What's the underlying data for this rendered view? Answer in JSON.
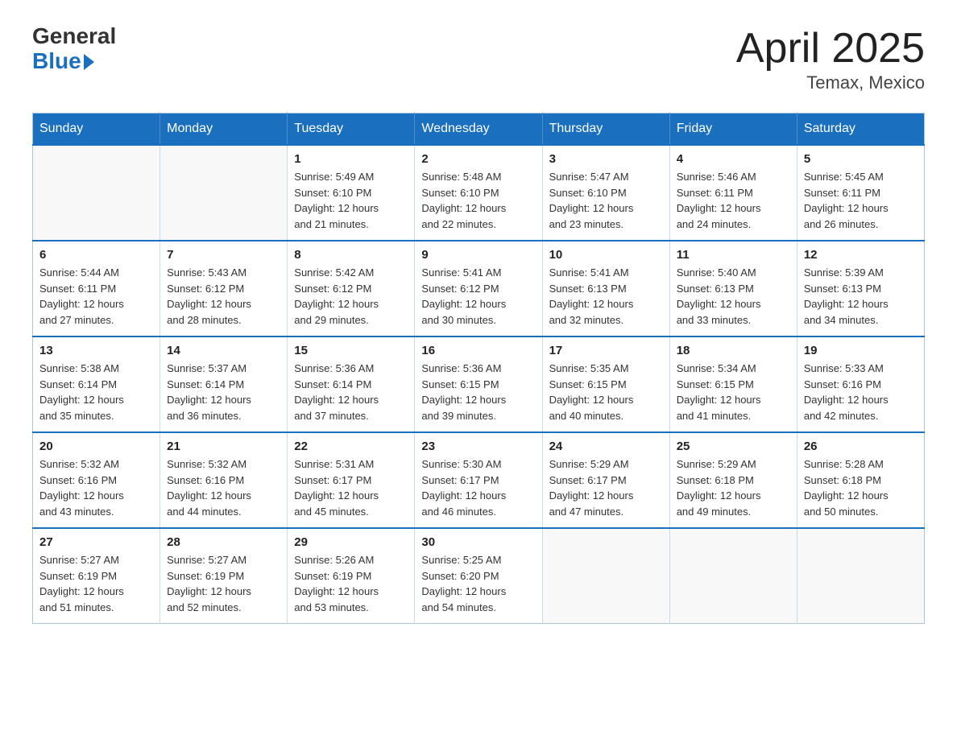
{
  "header": {
    "logo_general": "General",
    "logo_blue": "Blue",
    "title": "April 2025",
    "subtitle": "Temax, Mexico"
  },
  "calendar": {
    "days_of_week": [
      "Sunday",
      "Monday",
      "Tuesday",
      "Wednesday",
      "Thursday",
      "Friday",
      "Saturday"
    ],
    "weeks": [
      [
        {
          "day": "",
          "info": ""
        },
        {
          "day": "",
          "info": ""
        },
        {
          "day": "1",
          "info": "Sunrise: 5:49 AM\nSunset: 6:10 PM\nDaylight: 12 hours\nand 21 minutes."
        },
        {
          "day": "2",
          "info": "Sunrise: 5:48 AM\nSunset: 6:10 PM\nDaylight: 12 hours\nand 22 minutes."
        },
        {
          "day": "3",
          "info": "Sunrise: 5:47 AM\nSunset: 6:10 PM\nDaylight: 12 hours\nand 23 minutes."
        },
        {
          "day": "4",
          "info": "Sunrise: 5:46 AM\nSunset: 6:11 PM\nDaylight: 12 hours\nand 24 minutes."
        },
        {
          "day": "5",
          "info": "Sunrise: 5:45 AM\nSunset: 6:11 PM\nDaylight: 12 hours\nand 26 minutes."
        }
      ],
      [
        {
          "day": "6",
          "info": "Sunrise: 5:44 AM\nSunset: 6:11 PM\nDaylight: 12 hours\nand 27 minutes."
        },
        {
          "day": "7",
          "info": "Sunrise: 5:43 AM\nSunset: 6:12 PM\nDaylight: 12 hours\nand 28 minutes."
        },
        {
          "day": "8",
          "info": "Sunrise: 5:42 AM\nSunset: 6:12 PM\nDaylight: 12 hours\nand 29 minutes."
        },
        {
          "day": "9",
          "info": "Sunrise: 5:41 AM\nSunset: 6:12 PM\nDaylight: 12 hours\nand 30 minutes."
        },
        {
          "day": "10",
          "info": "Sunrise: 5:41 AM\nSunset: 6:13 PM\nDaylight: 12 hours\nand 32 minutes."
        },
        {
          "day": "11",
          "info": "Sunrise: 5:40 AM\nSunset: 6:13 PM\nDaylight: 12 hours\nand 33 minutes."
        },
        {
          "day": "12",
          "info": "Sunrise: 5:39 AM\nSunset: 6:13 PM\nDaylight: 12 hours\nand 34 minutes."
        }
      ],
      [
        {
          "day": "13",
          "info": "Sunrise: 5:38 AM\nSunset: 6:14 PM\nDaylight: 12 hours\nand 35 minutes."
        },
        {
          "day": "14",
          "info": "Sunrise: 5:37 AM\nSunset: 6:14 PM\nDaylight: 12 hours\nand 36 minutes."
        },
        {
          "day": "15",
          "info": "Sunrise: 5:36 AM\nSunset: 6:14 PM\nDaylight: 12 hours\nand 37 minutes."
        },
        {
          "day": "16",
          "info": "Sunrise: 5:36 AM\nSunset: 6:15 PM\nDaylight: 12 hours\nand 39 minutes."
        },
        {
          "day": "17",
          "info": "Sunrise: 5:35 AM\nSunset: 6:15 PM\nDaylight: 12 hours\nand 40 minutes."
        },
        {
          "day": "18",
          "info": "Sunrise: 5:34 AM\nSunset: 6:15 PM\nDaylight: 12 hours\nand 41 minutes."
        },
        {
          "day": "19",
          "info": "Sunrise: 5:33 AM\nSunset: 6:16 PM\nDaylight: 12 hours\nand 42 minutes."
        }
      ],
      [
        {
          "day": "20",
          "info": "Sunrise: 5:32 AM\nSunset: 6:16 PM\nDaylight: 12 hours\nand 43 minutes."
        },
        {
          "day": "21",
          "info": "Sunrise: 5:32 AM\nSunset: 6:16 PM\nDaylight: 12 hours\nand 44 minutes."
        },
        {
          "day": "22",
          "info": "Sunrise: 5:31 AM\nSunset: 6:17 PM\nDaylight: 12 hours\nand 45 minutes."
        },
        {
          "day": "23",
          "info": "Sunrise: 5:30 AM\nSunset: 6:17 PM\nDaylight: 12 hours\nand 46 minutes."
        },
        {
          "day": "24",
          "info": "Sunrise: 5:29 AM\nSunset: 6:17 PM\nDaylight: 12 hours\nand 47 minutes."
        },
        {
          "day": "25",
          "info": "Sunrise: 5:29 AM\nSunset: 6:18 PM\nDaylight: 12 hours\nand 49 minutes."
        },
        {
          "day": "26",
          "info": "Sunrise: 5:28 AM\nSunset: 6:18 PM\nDaylight: 12 hours\nand 50 minutes."
        }
      ],
      [
        {
          "day": "27",
          "info": "Sunrise: 5:27 AM\nSunset: 6:19 PM\nDaylight: 12 hours\nand 51 minutes."
        },
        {
          "day": "28",
          "info": "Sunrise: 5:27 AM\nSunset: 6:19 PM\nDaylight: 12 hours\nand 52 minutes."
        },
        {
          "day": "29",
          "info": "Sunrise: 5:26 AM\nSunset: 6:19 PM\nDaylight: 12 hours\nand 53 minutes."
        },
        {
          "day": "30",
          "info": "Sunrise: 5:25 AM\nSunset: 6:20 PM\nDaylight: 12 hours\nand 54 minutes."
        },
        {
          "day": "",
          "info": ""
        },
        {
          "day": "",
          "info": ""
        },
        {
          "day": "",
          "info": ""
        }
      ]
    ]
  }
}
